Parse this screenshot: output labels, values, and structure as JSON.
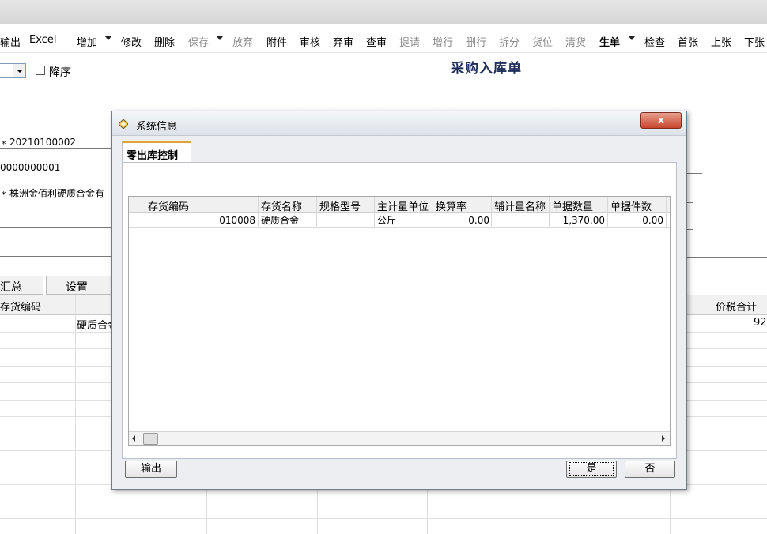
{
  "toolbar": {
    "items": [
      {
        "label": "输出",
        "disabled": false
      },
      {
        "label": "Excel",
        "disabled": false
      },
      {
        "label": "增加",
        "disabled": false
      },
      {
        "label": "修改",
        "disabled": false
      },
      {
        "label": "删除",
        "disabled": false
      },
      {
        "label": "保存",
        "disabled": true
      },
      {
        "label": "放弃",
        "disabled": true
      },
      {
        "label": "附件",
        "disabled": false
      },
      {
        "label": "审核",
        "disabled": false
      },
      {
        "label": "弃审",
        "disabled": false
      },
      {
        "label": "查审",
        "disabled": false
      },
      {
        "label": "提请",
        "disabled": true
      },
      {
        "label": "增行",
        "disabled": true
      },
      {
        "label": "删行",
        "disabled": true
      },
      {
        "label": "拆分",
        "disabled": true
      },
      {
        "label": "货位",
        "disabled": true
      },
      {
        "label": "清货",
        "disabled": true
      },
      {
        "label": "生单",
        "disabled": false
      },
      {
        "label": "检查",
        "disabled": false
      },
      {
        "label": "首张",
        "disabled": false
      },
      {
        "label": "上张",
        "disabled": false
      },
      {
        "label": "下张",
        "disabled": false
      }
    ]
  },
  "form": {
    "title": "采购入库单",
    "descending_label": "降序",
    "required_mark": "*",
    "doc_no": "20210100002",
    "code_value": "0000000001",
    "supplier": "株洲金佰利硬质合金有",
    "tab_summary": "汇总",
    "tab_settings": "设置",
    "grid_col_code": "存货编码",
    "grid_col_total": "价税合计",
    "row1_name": "硬质合金",
    "row1_total": "92,"
  },
  "dialog": {
    "title": "系统信息",
    "close_label": "x",
    "tab_label": "零出库控制",
    "columns": [
      "存货编码",
      "存货名称",
      "规格型号",
      "主计量单位",
      "换算率",
      "辅计量名称",
      "单据数量",
      "单据件数"
    ],
    "rows": [
      {
        "code": "010008",
        "name": "硬质合金",
        "spec": "",
        "unit": "公斤",
        "rate": "0.00",
        "aux_unit": "",
        "qty": "1,370.00",
        "pieces": "0.00"
      }
    ],
    "btn_output": "输出",
    "btn_yes": "是",
    "btn_no": "否"
  },
  "colors": {
    "title_text": "#1f2f5a",
    "close_button": "#c8452f",
    "active_tab_accent": "#e0a43a"
  }
}
